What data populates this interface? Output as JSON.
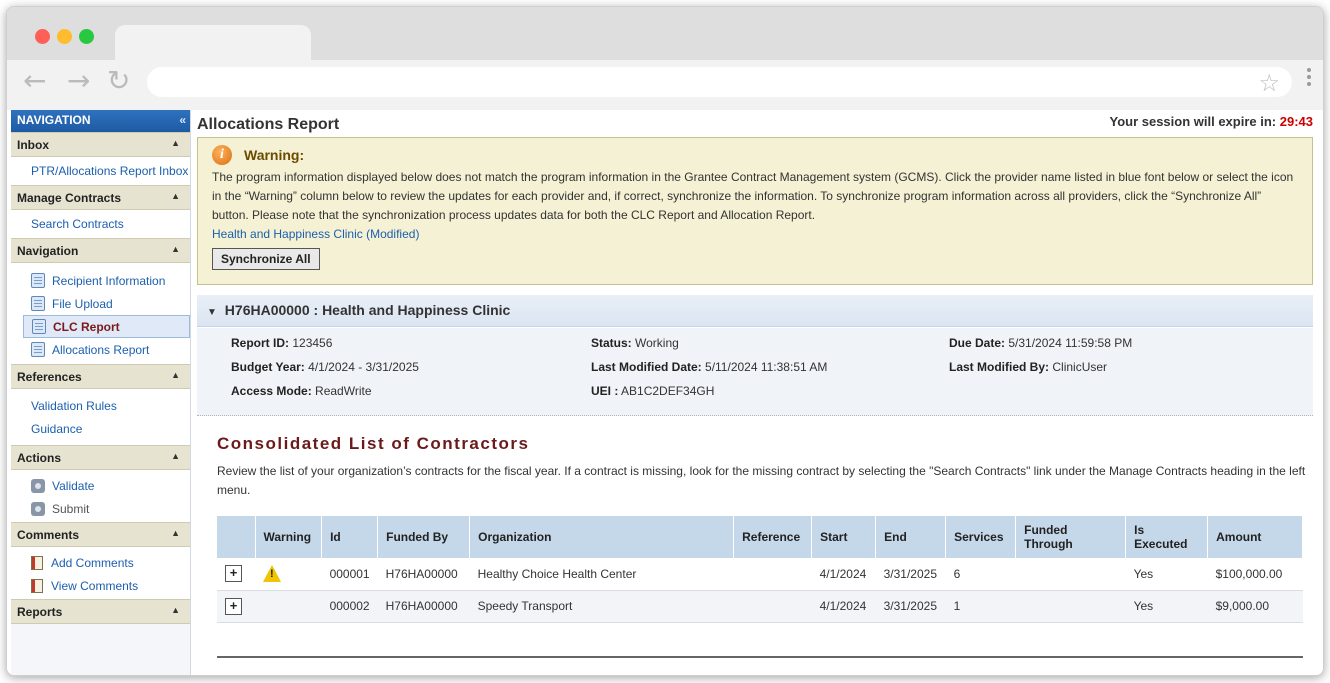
{
  "browser": {
    "url": ""
  },
  "sidebar": {
    "header": "NAVIGATION",
    "collapse_icon": "double-chevron-left-icon",
    "sections": [
      {
        "title": "Inbox",
        "links": [
          "PTR/Allocations Report Inbox"
        ]
      },
      {
        "title": "Manage Contracts",
        "links": [
          "Search Contracts"
        ]
      },
      {
        "title": "Navigation",
        "items": [
          "Recipient Information",
          "File Upload",
          "CLC Report",
          "Allocations Report"
        ],
        "active": "CLC Report"
      },
      {
        "title": "References",
        "links": [
          "Validation Rules",
          "Guidance"
        ]
      },
      {
        "title": "Actions",
        "items": [
          "Validate",
          "Submit"
        ]
      },
      {
        "title": "Comments",
        "items": [
          "Add Comments",
          "View Comments"
        ]
      },
      {
        "title": "Reports"
      }
    ]
  },
  "header": {
    "title": "Allocations Report",
    "session_label": "Your session will expire in:",
    "session_time": "29:43"
  },
  "warning": {
    "title": "Warning:",
    "text": "The program information displayed below does not match the program information in the Grantee Contract Management system (GCMS). Click the provider name listed in blue font below or select the icon in the “Warning” column below to review the updates for each provider and, if correct, synchronize the information. To synchronize program information across all providers, click the “Synchronize All” button. Please note that the synchronization process updates data for both the CLC Report and Allocation Report.",
    "link": "Health and Happiness Clinic (Modified)",
    "button": "Synchronize All"
  },
  "program": {
    "heading": "H76HA00000 : Health and Happiness Clinic",
    "fields": {
      "report_id_label": "Report ID:",
      "report_id": "123456",
      "budget_year_label": "Budget Year:",
      "budget_year": "4/1/2024 - 3/31/2025",
      "access_mode_label": "Access Mode:",
      "access_mode": "ReadWrite",
      "status_label": "Status:",
      "status": "Working",
      "last_modified_label": "Last Modified Date:",
      "last_modified": "5/11/2024 11:38:51 AM",
      "uei_label": "UEI :",
      "uei": "AB1C2DEF34GH",
      "due_date_label": "Due Date:",
      "due_date": "5/31/2024 11:59:58 PM",
      "last_modified_by_label": "Last Modified By:",
      "last_modified_by": "ClinicUser"
    }
  },
  "contractors": {
    "title": "Consolidated List of Contractors",
    "description": "Review the list of your organization’s contracts for the fiscal year. If a contract is missing, look for the missing contract by selecting the \"Search Contracts\" link under the Manage Contracts heading in the left menu.",
    "columns": [
      "",
      "Warning",
      "Id",
      "Funded By",
      "Organization",
      "Reference",
      "Start",
      "End",
      "Services",
      "Funded Through",
      "Is Executed",
      "Amount"
    ],
    "rows": [
      {
        "expander": "+",
        "warning": "!",
        "id": "000001",
        "funded_by": "H76HA00000",
        "organization": "Healthy Choice Health Center",
        "reference": "",
        "start": "4/1/2024",
        "end": "3/31/2025",
        "services": "6",
        "funded_through": "",
        "is_executed": "Yes",
        "amount": "$100,000.00"
      },
      {
        "expander": "+",
        "warning": "",
        "id": "000002",
        "funded_by": "H76HA00000",
        "organization": "Speedy Transport",
        "reference": "",
        "start": "4/1/2024",
        "end": "3/31/2025",
        "services": "1",
        "funded_through": "",
        "is_executed": "Yes",
        "amount": "$9,000.00"
      }
    ]
  }
}
